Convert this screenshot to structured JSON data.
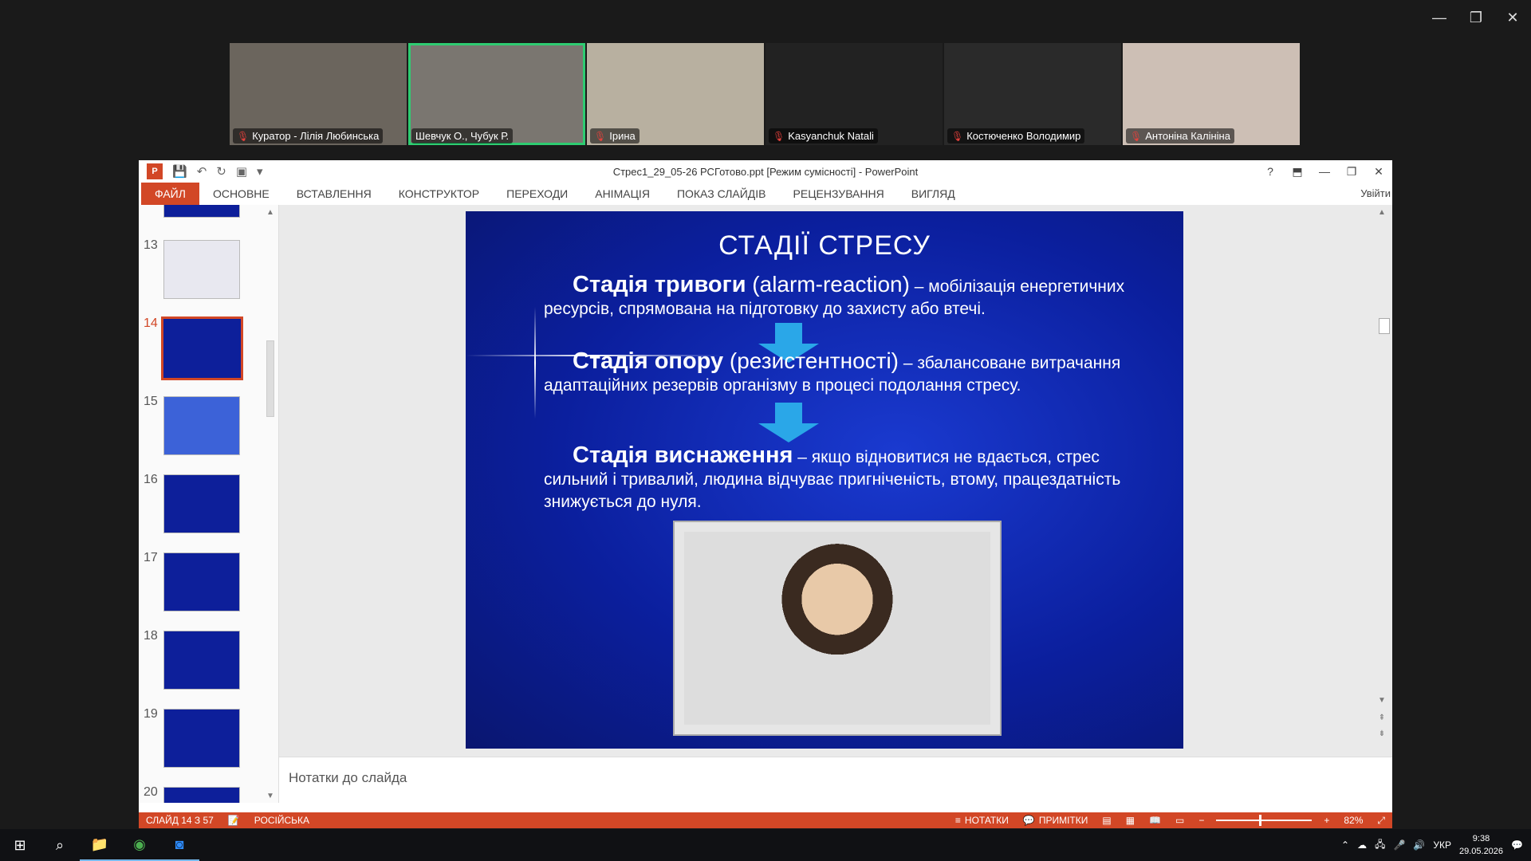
{
  "zoom": {
    "participants": [
      {
        "name": "Куратор - Лілія Любинська",
        "muted": true,
        "active": false
      },
      {
        "name": "Шевчук О., Чубук Р.",
        "muted": false,
        "active": true
      },
      {
        "name": "Ірина",
        "muted": true,
        "active": false
      },
      {
        "name": "Kasyanchuk Natali",
        "muted": true,
        "active": false
      },
      {
        "name": "Костюченко Володимир",
        "muted": true,
        "active": false
      },
      {
        "name": "Антоніна Калініна",
        "muted": true,
        "active": false
      }
    ]
  },
  "ppt": {
    "title": "Стрес1_29_05-26 РСГотово.ppt [Режим сумісності] - PowerPoint",
    "signin": "Увійти",
    "tabs": [
      "ФАЙЛ",
      "ОСНОВНЕ",
      "ВСТАВЛЕННЯ",
      "КОНСТРУКТОР",
      "ПЕРЕХОДИ",
      "АНІМАЦІЯ",
      "ПОКАЗ СЛАЙДІВ",
      "РЕЦЕНЗУВАННЯ",
      "ВИГЛЯД"
    ],
    "thumbnails": [
      "13",
      "14",
      "15",
      "16",
      "17",
      "18",
      "19",
      "20"
    ],
    "selected_slide": "14",
    "slide": {
      "title": "СТАДІЇ СТРЕСУ",
      "p1": {
        "lead": "Стадія тривоги",
        "latin": " (alarm-reaction)",
        "rest": " – мобілізація енергетичних ресурсів, спрямована на підготовку до захисту або втечі."
      },
      "p2": {
        "lead": "Стадія опору",
        "latin": " (резистентності)",
        "rest": " – збалансоване витрачання адаптаційних резервів організму в процесі подолання стресу."
      },
      "p3": {
        "lead": "Стадія виснаження",
        "rest": " – якщо відновитися не вдається, стрес сильний і тривалий, людина відчуває пригніченість, втому, працездатність знижується до нуля."
      }
    },
    "notes_placeholder": "Нотатки до слайда",
    "status": {
      "slide_counter": "СЛАЙД 14 З 57",
      "language": "РОСІЙСЬКА",
      "notes": "НОТАТКИ",
      "comments": "ПРИМІТКИ",
      "zoom": "82%"
    }
  },
  "taskbar": {
    "lang": "УКР",
    "time": "9:38",
    "date": "29.05.2026"
  },
  "colors": {
    "ppt_accent": "#d24726",
    "slide_bg": "#0b1f9e",
    "zoom_active": "#2ecc71"
  }
}
